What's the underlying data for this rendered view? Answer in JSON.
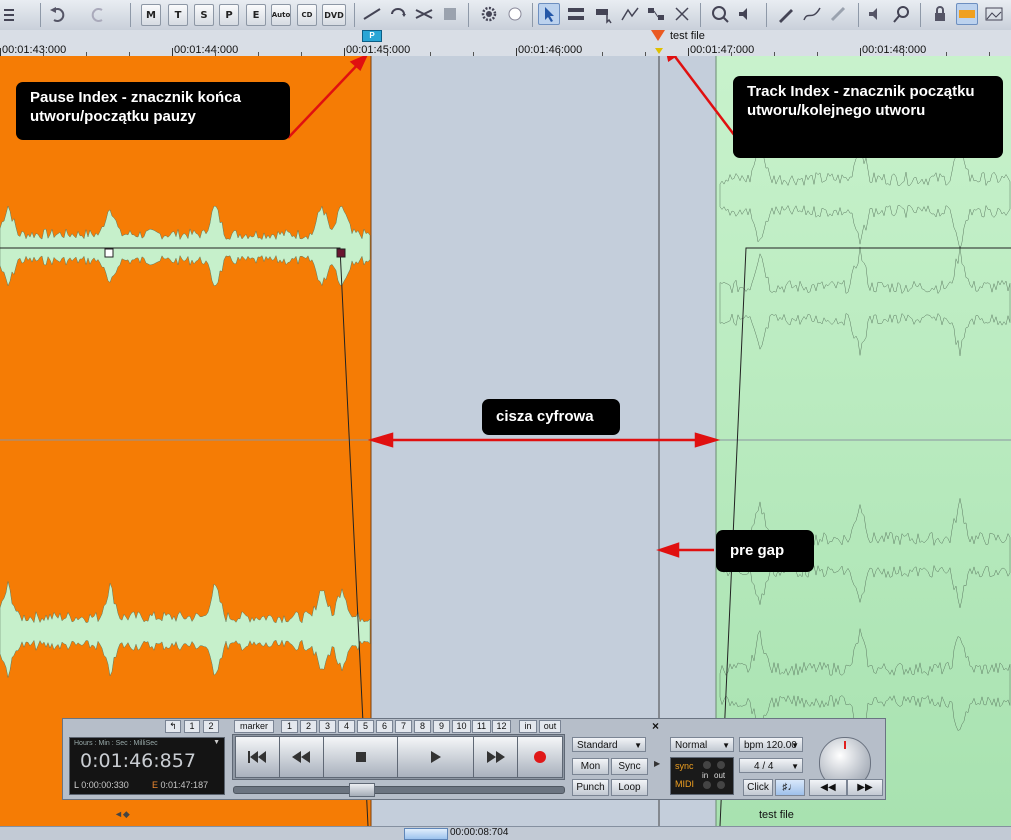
{
  "toolbar": {
    "btn_m": "M",
    "btn_t": "T",
    "btn_s": "S",
    "btn_p": "P",
    "btn_e": "E",
    "btn_auto": "Auto",
    "btn_cd": "CD",
    "btn_dvd": "DVD"
  },
  "ruler": {
    "labels": [
      "00:01:43:000",
      "00:01:44:000",
      "00:01:45:000",
      "00:01:46:000",
      "00:01:47:000",
      "00:01:48:000"
    ],
    "pause_marker": "P",
    "track_marker_label": "test file"
  },
  "annotations": {
    "pause_index": "Pause Index - znacznik końca utworu/początku pauzy",
    "track_index": "Track Index - znacznik początku utworu/kolejnego utworu",
    "digital_silence": "cisza cyfrowa",
    "pre_gap": "pre gap"
  },
  "transport": {
    "undo_btn": "↰",
    "top_1": "1",
    "top_2": "2",
    "marker_label": "marker",
    "marker_numbers": [
      "1",
      "2",
      "3",
      "4",
      "5",
      "6",
      "7",
      "8",
      "9",
      "10",
      "11",
      "12"
    ],
    "in_label": "in",
    "out_label": "out",
    "time_format": "Hours : Min : Sec : MilliSec",
    "current_time": "0:01:46:857",
    "l_label": "L",
    "l_time": "0:00:00:330",
    "e_label": "E",
    "e_time": "0:01:47:187",
    "mode_dropdown": "Standard",
    "mon": "Mon",
    "sync": "Sync",
    "punch": "Punch",
    "loop": "Loop",
    "normal_dropdown": "Normal",
    "bpm": "bpm 120.00",
    "signature": "4 / 4",
    "sync_label": "sync",
    "midi_label": "MIDI",
    "in_small": "in",
    "out_small": "out",
    "click": "Click",
    "close_icon": "×"
  },
  "bottom": {
    "track_label": "test file",
    "length": "00:00:08:704"
  }
}
